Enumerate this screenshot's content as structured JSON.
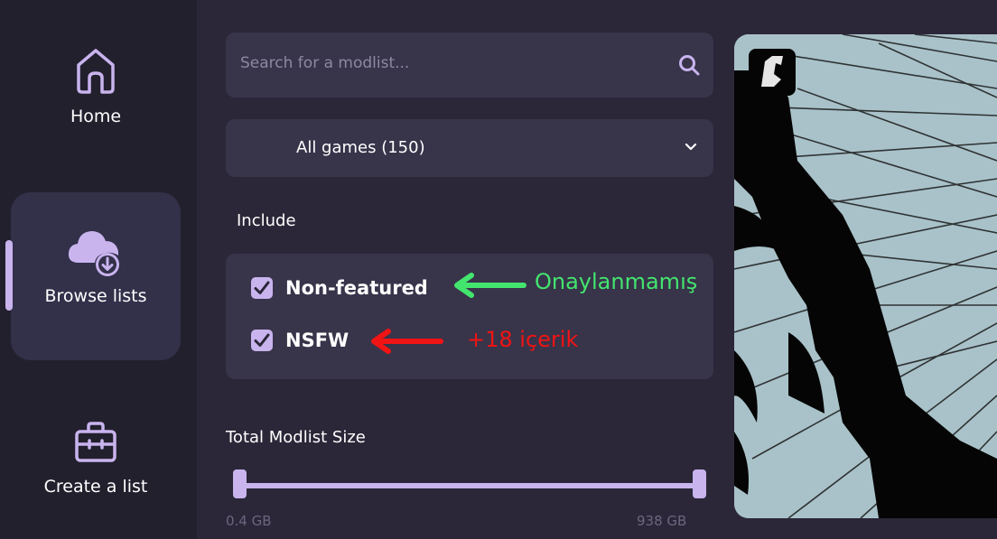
{
  "sidebar": {
    "items": [
      {
        "label": "Home",
        "icon": "home-icon"
      },
      {
        "label": "Browse lists",
        "icon": "cloud-download-icon",
        "active": true
      },
      {
        "label": "Create a list",
        "icon": "toolbox-icon"
      }
    ]
  },
  "filters": {
    "search_placeholder": "Search for a modlist...",
    "game_select": "All games (150)",
    "include_title": "Include",
    "options": [
      {
        "label": "Non-featured",
        "checked": true
      },
      {
        "label": "NSFW",
        "checked": true
      }
    ],
    "size_title": "Total Modlist Size",
    "size_min": "0.4 GB",
    "size_max": "938 GB",
    "size_range_fraction": [
      0,
      1
    ]
  },
  "annotations": {
    "green_text": "Onaylanmamış",
    "red_text": "+18 içerik"
  },
  "colors": {
    "accent": "#c9b4ee",
    "annotation_green": "#43e56e",
    "annotation_red": "#f01414"
  }
}
